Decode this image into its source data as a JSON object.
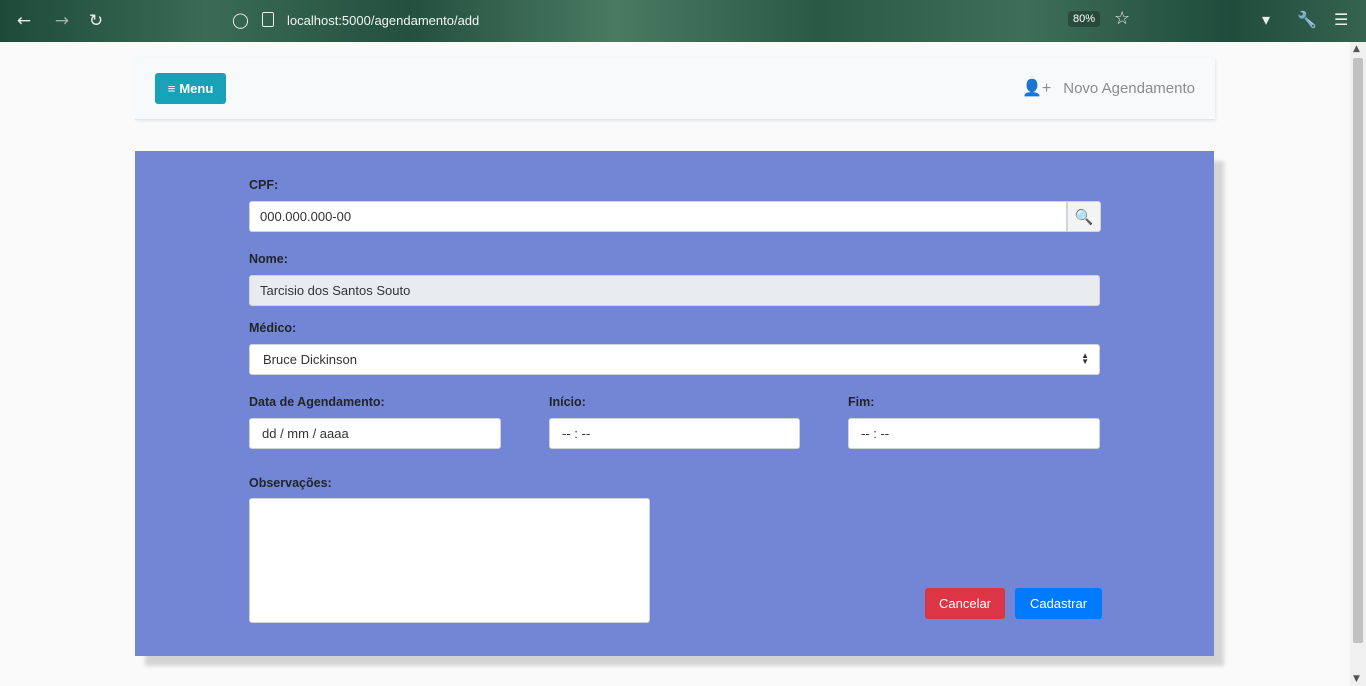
{
  "browser": {
    "url": "localhost:5000/agendamento/add",
    "zoom": "80%"
  },
  "nav": {
    "menu_label": "Menu",
    "page_title": "Novo Agendamento"
  },
  "form": {
    "cpf": {
      "label": "CPF:",
      "value": "000.000.000-00"
    },
    "nome": {
      "label": "Nome:",
      "value": "Tarcisio dos Santos Souto"
    },
    "medico": {
      "label": "Médico:",
      "selected": "Bruce Dickinson"
    },
    "data": {
      "label": "Data de Agendamento:",
      "value": "dd / mm / aaaa"
    },
    "inicio": {
      "label": "Início:",
      "value": "-- : --"
    },
    "fim": {
      "label": "Fim:",
      "value": "-- : --"
    },
    "observacoes": {
      "label": "Observações:",
      "value": ""
    },
    "cancel_label": "Cancelar",
    "submit_label": "Cadastrar"
  },
  "colors": {
    "card_bg": "#7386d5",
    "menu_btn": "#17a2b8",
    "cancel": "#dc3545",
    "submit": "#007bff"
  },
  "icons": {
    "back": "back-arrow-icon",
    "forward": "forward-arrow-icon",
    "reload": "reload-icon",
    "shield": "shield-icon",
    "page": "page-icon",
    "star": "star-icon",
    "pocket": "pocket-icon",
    "wrench": "wrench-icon",
    "hamburger": "hamburger-icon",
    "user_plus": "user-plus-icon",
    "search": "search-icon",
    "select_arrows": "select-arrows-icon"
  }
}
